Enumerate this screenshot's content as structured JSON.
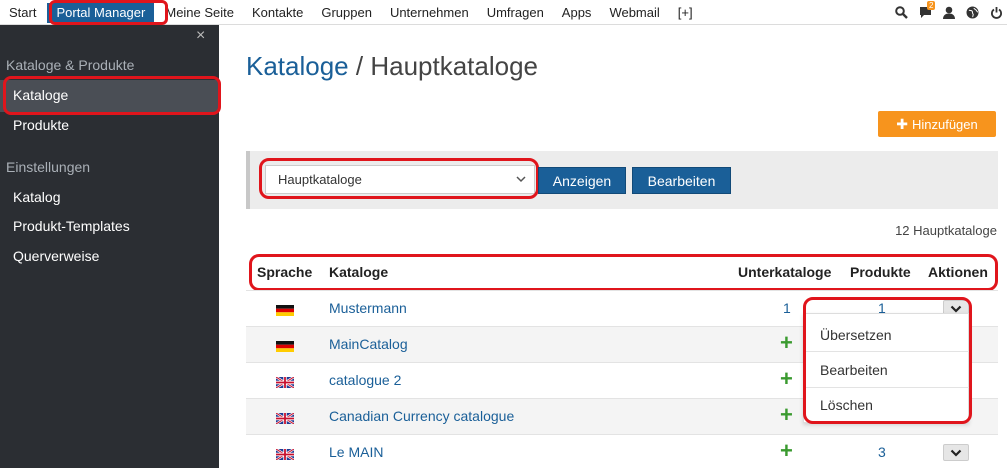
{
  "nav": {
    "items": [
      "Start",
      "Portal Manager",
      "Meine Seite",
      "Kontakte",
      "Gruppen",
      "Unternehmen",
      "Umfragen",
      "Apps",
      "Webmail",
      "[+]"
    ],
    "active_index": 1,
    "icons": [
      "search-icon",
      "chat-icon",
      "user-icon",
      "globe-icon",
      "power-icon"
    ],
    "chat_badge": "2"
  },
  "sidebar": {
    "close": "×",
    "section1": "Kataloge & Produkte",
    "items1": [
      "Kataloge",
      "Produkte"
    ],
    "section2": "Einstellungen",
    "items2": [
      "Katalog",
      "Produkt-Templates",
      "Querverweise"
    ]
  },
  "main": {
    "title_link": "Kataloge",
    "title_sep": " / ",
    "title_rest": "Hauptkataloge",
    "add_button": "Hinzufügen",
    "select_value": "Hauptkataloge",
    "show_button": "Anzeigen",
    "edit_button": "Bearbeiten",
    "count": "12 Hauptkataloge"
  },
  "table": {
    "headers": [
      "Sprache",
      "Kataloge",
      "Unterkataloge",
      "Produkte",
      "Aktionen"
    ],
    "rows": [
      {
        "flag": "de",
        "name": "Mustermann",
        "sub": "1",
        "prod": "1"
      },
      {
        "flag": "de",
        "name": "MainCatalog",
        "sub": "+",
        "prod": ""
      },
      {
        "flag": "uk",
        "name": "catalogue 2",
        "sub": "+",
        "prod": ""
      },
      {
        "flag": "uk",
        "name": "Canadian Currency catalogue",
        "sub": "+",
        "prod": ""
      },
      {
        "flag": "uk",
        "name": "Le MAIN",
        "sub": "+",
        "prod": "3"
      }
    ]
  },
  "dropdown": {
    "items": [
      "Übersetzen",
      "Bearbeiten",
      "Löschen"
    ]
  },
  "colors": {
    "accent": "#1a5f98",
    "orange": "#f7941d",
    "highlight": "#e0151c",
    "sidebar": "#2b2e33",
    "green": "#3a9a2f"
  }
}
